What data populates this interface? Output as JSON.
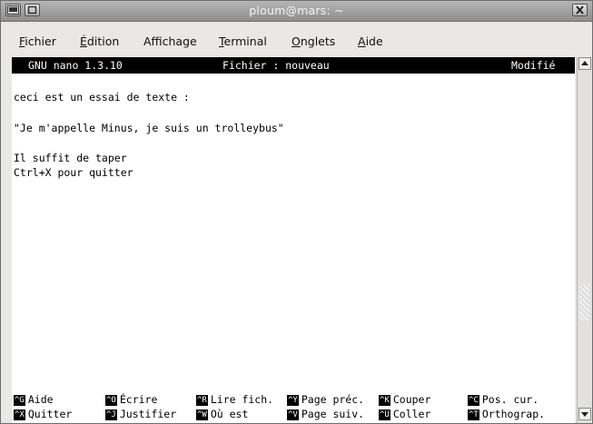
{
  "window": {
    "title": "ploum@mars: ~"
  },
  "menubar": {
    "items": [
      {
        "accel": "F",
        "rest": "ichier"
      },
      {
        "accel": "É",
        "rest": "dition"
      },
      {
        "accel": "",
        "rest": "Affichage"
      },
      {
        "accel": "T",
        "rest": "erminal"
      },
      {
        "accel": "O",
        "rest": "nglets"
      },
      {
        "accel": "A",
        "rest": "ide"
      }
    ]
  },
  "nano": {
    "version": "GNU nano 1.3.10",
    "file": "Fichier : nouveau",
    "state": "Modifié",
    "lines": [
      "ceci est un essai de texte :",
      "",
      "\"Je m'appelle Minus, je suis un trolleybus\"",
      "",
      "Il suffit de taper",
      "Ctrl+X pour quitter"
    ],
    "shortcuts_row1": [
      {
        "key": "^G",
        "label": "Aide"
      },
      {
        "key": "^O",
        "label": "Écrire"
      },
      {
        "key": "^R",
        "label": "Lire fich."
      },
      {
        "key": "^Y",
        "label": "Page préc."
      },
      {
        "key": "^K",
        "label": "Couper"
      },
      {
        "key": "^C",
        "label": "Pos. cur."
      }
    ],
    "shortcuts_row2": [
      {
        "key": "^X",
        "label": "Quitter"
      },
      {
        "key": "^J",
        "label": "Justifier"
      },
      {
        "key": "^W",
        "label": "Où est"
      },
      {
        "key": "^V",
        "label": "Page suiv."
      },
      {
        "key": "^U",
        "label": "Coller"
      },
      {
        "key": "^T",
        "label": "Orthograp."
      }
    ]
  },
  "icons": {
    "window_icon": "terminal-icon",
    "maximize": "maximize-icon",
    "close": "close-icon",
    "scroll_up": "arrow-up-icon",
    "scroll_down": "arrow-down-icon"
  },
  "colors": {
    "statusbar_bg": "#000000",
    "statusbar_fg": "#ffffff",
    "terminal_bg": "#ffffff"
  }
}
